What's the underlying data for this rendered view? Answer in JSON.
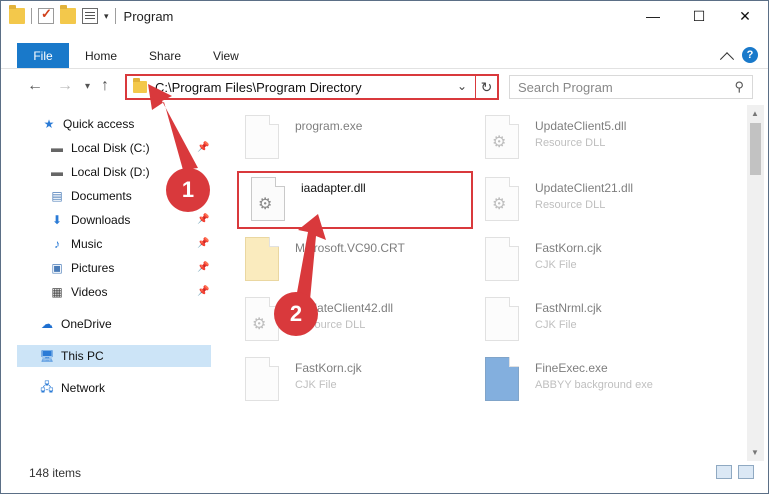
{
  "window": {
    "title": "Program",
    "minimize": "—",
    "maximize": "☐",
    "close": "✕"
  },
  "ribbon": {
    "tabs": [
      "File",
      "Home",
      "Share",
      "View"
    ]
  },
  "address": {
    "path": "C:\\Program Files\\Program Directory",
    "search_placeholder": "Search Program"
  },
  "nav": {
    "items": [
      {
        "label": "Quick access"
      },
      {
        "label": "Local Disk (C:)"
      },
      {
        "label": "Local Disk (D:)"
      },
      {
        "label": "Documents"
      },
      {
        "label": "Downloads"
      },
      {
        "label": "Music"
      },
      {
        "label": "Pictures"
      },
      {
        "label": "Videos"
      },
      {
        "label": "OneDrive"
      },
      {
        "label": "This PC"
      },
      {
        "label": "Network"
      }
    ]
  },
  "files": [
    {
      "name": "program.exe",
      "type": ""
    },
    {
      "name": "UpdateClient5.dll",
      "type": "Resource DLL"
    },
    {
      "name": "iaadapter.dll",
      "type": ""
    },
    {
      "name": "UpdateClient21.dll",
      "type": "Resource DLL"
    },
    {
      "name": "Microsoft.VC90.CRT",
      "type": ""
    },
    {
      "name": "FastKorn.cjk",
      "type": "CJK File"
    },
    {
      "name": "UpdateClient42.dll",
      "type": "Resource DLL"
    },
    {
      "name": "FastNrml.cjk",
      "type": "CJK File"
    },
    {
      "name": "FastKorn.cjk",
      "type": "CJK File"
    },
    {
      "name": "FineExec.exe",
      "type": "ABBYY background exe"
    }
  ],
  "status": {
    "count": "148 items"
  },
  "annotations": {
    "badge1": "1",
    "badge2": "2",
    "color": "#d9393c"
  }
}
